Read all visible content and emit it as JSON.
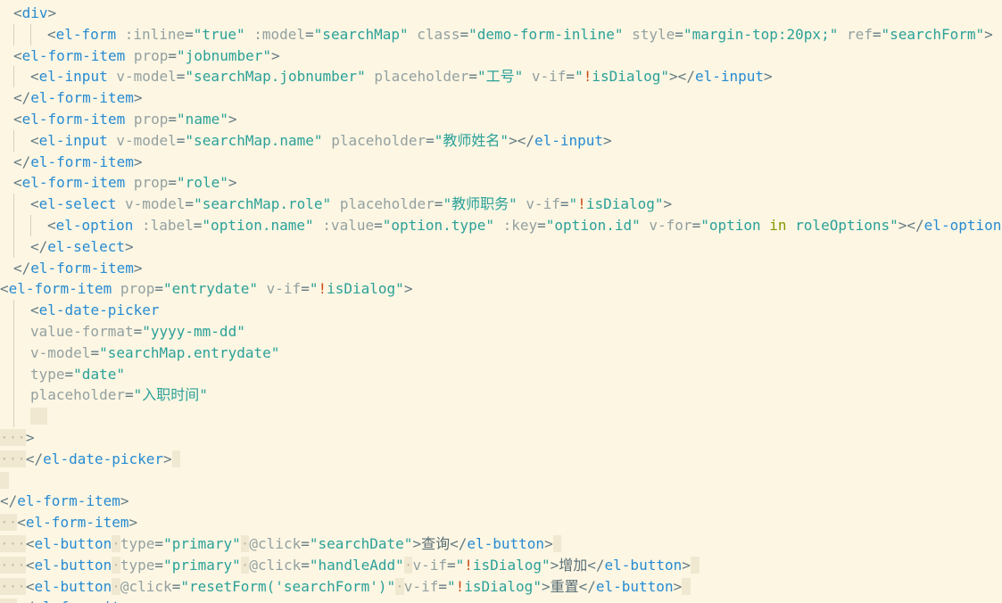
{
  "colors": {
    "background": "#fdf6e3",
    "tag": "#268bd2",
    "attribute": "#93a1a1",
    "string": "#2aa198",
    "keyword": "#859900",
    "text": "#586e75",
    "whitespace_highlight": "#f0e8d0"
  },
  "lines": [
    {
      "indent": 15,
      "guides": [],
      "tokens": [
        [
          "punc",
          "<"
        ],
        [
          "tag",
          "div"
        ],
        [
          "punc",
          ">"
        ]
      ]
    },
    {
      "indent": 53,
      "guides": [
        15,
        34
      ],
      "tokens": [
        [
          "punc",
          "<"
        ],
        [
          "tag",
          "el-form"
        ],
        [
          "text",
          " "
        ],
        [
          "attr",
          ":inline"
        ],
        [
          "punc",
          "="
        ],
        [
          "str",
          "\"true\""
        ],
        [
          "text",
          " "
        ],
        [
          "attr",
          ":model"
        ],
        [
          "punc",
          "="
        ],
        [
          "str",
          "\"searchMap\""
        ],
        [
          "text",
          " "
        ],
        [
          "attr",
          "class"
        ],
        [
          "punc",
          "="
        ],
        [
          "str",
          "\"demo-form-inline\""
        ],
        [
          "text",
          " "
        ],
        [
          "attr",
          "style"
        ],
        [
          "punc",
          "="
        ],
        [
          "str",
          "\"margin-top:20px;\""
        ],
        [
          "text",
          " "
        ],
        [
          "attr",
          "ref"
        ],
        [
          "punc",
          "="
        ],
        [
          "str",
          "\"searchForm\""
        ],
        [
          "punc",
          ">"
        ]
      ]
    },
    {
      "indent": 15,
      "guides": [],
      "tokens": [
        [
          "punc",
          "<"
        ],
        [
          "tag",
          "el-form-item"
        ],
        [
          "text",
          " "
        ],
        [
          "attr",
          "prop"
        ],
        [
          "punc",
          "="
        ],
        [
          "str",
          "\"jobnumber\""
        ],
        [
          "punc",
          ">"
        ]
      ]
    },
    {
      "indent": 34,
      "guides": [
        15
      ],
      "tokens": [
        [
          "punc",
          "<"
        ],
        [
          "tag",
          "el-input"
        ],
        [
          "text",
          " "
        ],
        [
          "attr",
          "v-model"
        ],
        [
          "punc",
          "="
        ],
        [
          "str",
          "\"searchMap.jobnumber\""
        ],
        [
          "text",
          " "
        ],
        [
          "attr",
          "placeholder"
        ],
        [
          "punc",
          "="
        ],
        [
          "str",
          "\"工号\""
        ],
        [
          "text",
          " "
        ],
        [
          "attr",
          "v-if"
        ],
        [
          "punc",
          "="
        ],
        [
          "str",
          "\""
        ],
        [
          "bang",
          "!"
        ],
        [
          "str",
          "isDialog\""
        ],
        [
          "punc",
          "></"
        ],
        [
          "tag",
          "el-input"
        ],
        [
          "punc",
          ">"
        ]
      ]
    },
    {
      "indent": 15,
      "guides": [],
      "tokens": [
        [
          "punc",
          "</"
        ],
        [
          "tag",
          "el-form-item"
        ],
        [
          "punc",
          ">"
        ]
      ]
    },
    {
      "indent": 15,
      "guides": [],
      "tokens": [
        [
          "punc",
          "<"
        ],
        [
          "tag",
          "el-form-item"
        ],
        [
          "text",
          " "
        ],
        [
          "attr",
          "prop"
        ],
        [
          "punc",
          "="
        ],
        [
          "str",
          "\"name\""
        ],
        [
          "punc",
          ">"
        ]
      ]
    },
    {
      "indent": 34,
      "guides": [
        15
      ],
      "tokens": [
        [
          "punc",
          "<"
        ],
        [
          "tag",
          "el-input"
        ],
        [
          "text",
          " "
        ],
        [
          "attr",
          "v-model"
        ],
        [
          "punc",
          "="
        ],
        [
          "str",
          "\"searchMap.name\""
        ],
        [
          "text",
          " "
        ],
        [
          "attr",
          "placeholder"
        ],
        [
          "punc",
          "="
        ],
        [
          "str",
          "\"教师姓名\""
        ],
        [
          "punc",
          "></"
        ],
        [
          "tag",
          "el-input"
        ],
        [
          "punc",
          ">"
        ]
      ]
    },
    {
      "indent": 15,
      "guides": [],
      "tokens": [
        [
          "punc",
          "</"
        ],
        [
          "tag",
          "el-form-item"
        ],
        [
          "punc",
          ">"
        ]
      ]
    },
    {
      "indent": 15,
      "guides": [],
      "tokens": [
        [
          "punc",
          "<"
        ],
        [
          "tag",
          "el-form-item"
        ],
        [
          "text",
          " "
        ],
        [
          "attr",
          "prop"
        ],
        [
          "punc",
          "="
        ],
        [
          "str",
          "\"role\""
        ],
        [
          "punc",
          ">"
        ]
      ]
    },
    {
      "indent": 34,
      "guides": [
        15
      ],
      "tokens": [
        [
          "punc",
          "<"
        ],
        [
          "tag",
          "el-select"
        ],
        [
          "text",
          " "
        ],
        [
          "attr",
          "v-model"
        ],
        [
          "punc",
          "="
        ],
        [
          "str",
          "\"searchMap.role\""
        ],
        [
          "text",
          " "
        ],
        [
          "attr",
          "placeholder"
        ],
        [
          "punc",
          "="
        ],
        [
          "str",
          "\"教师职务\""
        ],
        [
          "text",
          " "
        ],
        [
          "attr",
          "v-if"
        ],
        [
          "punc",
          "="
        ],
        [
          "str",
          "\""
        ],
        [
          "bang",
          "!"
        ],
        [
          "str",
          "isDialog\""
        ],
        [
          "punc",
          ">"
        ]
      ]
    },
    {
      "indent": 53,
      "guides": [
        15,
        34
      ],
      "tokens": [
        [
          "punc",
          "<"
        ],
        [
          "tag",
          "el-option"
        ],
        [
          "text",
          " "
        ],
        [
          "attr",
          ":label"
        ],
        [
          "punc",
          "="
        ],
        [
          "str",
          "\"option.name\""
        ],
        [
          "text",
          " "
        ],
        [
          "attr",
          ":value"
        ],
        [
          "punc",
          "="
        ],
        [
          "str",
          "\"option.type\""
        ],
        [
          "text",
          " "
        ],
        [
          "attr",
          ":key"
        ],
        [
          "punc",
          "="
        ],
        [
          "str",
          "\"option.id\""
        ],
        [
          "text",
          " "
        ],
        [
          "attr",
          "v-for"
        ],
        [
          "punc",
          "="
        ],
        [
          "str",
          "\"option "
        ],
        [
          "kw",
          "in"
        ],
        [
          "str",
          " roleOptions\""
        ],
        [
          "punc",
          "></"
        ],
        [
          "tag",
          "el-option"
        ],
        [
          "punc",
          ">"
        ]
      ]
    },
    {
      "indent": 34,
      "guides": [
        15
      ],
      "tokens": [
        [
          "punc",
          "</"
        ],
        [
          "tag",
          "el-select"
        ],
        [
          "punc",
          ">"
        ]
      ]
    },
    {
      "indent": 15,
      "guides": [],
      "tokens": [
        [
          "punc",
          "</"
        ],
        [
          "tag",
          "el-form-item"
        ],
        [
          "punc",
          ">"
        ]
      ]
    },
    {
      "indent": 0,
      "guides": [],
      "tokens": [
        [
          "punc",
          "<"
        ],
        [
          "tag",
          "el-form-item"
        ],
        [
          "text",
          " "
        ],
        [
          "attr",
          "prop"
        ],
        [
          "punc",
          "="
        ],
        [
          "str",
          "\"entrydate\""
        ],
        [
          "text",
          " "
        ],
        [
          "attr",
          "v-if"
        ],
        [
          "punc",
          "="
        ],
        [
          "str",
          "\""
        ],
        [
          "bang",
          "!"
        ],
        [
          "str",
          "isDialog\""
        ],
        [
          "punc",
          ">"
        ]
      ]
    },
    {
      "indent": 34,
      "guides": [
        15
      ],
      "tokens": [
        [
          "punc",
          "<"
        ],
        [
          "tag",
          "el-date-picker"
        ]
      ]
    },
    {
      "indent": 34,
      "guides": [
        15
      ],
      "tokens": [
        [
          "attr",
          "value-format"
        ],
        [
          "punc",
          "="
        ],
        [
          "str",
          "\"yyyy-mm-dd\""
        ]
      ]
    },
    {
      "indent": 34,
      "guides": [
        15
      ],
      "tokens": [
        [
          "attr",
          "v-model"
        ],
        [
          "punc",
          "="
        ],
        [
          "str",
          "\"searchMap.entrydate\""
        ]
      ]
    },
    {
      "indent": 34,
      "guides": [
        15
      ],
      "tokens": [
        [
          "attr",
          "type"
        ],
        [
          "punc",
          "="
        ],
        [
          "str",
          "\"date\""
        ]
      ]
    },
    {
      "indent": 34,
      "guides": [
        15
      ],
      "tokens": [
        [
          "attr",
          "placeholder"
        ],
        [
          "punc",
          "="
        ],
        [
          "str",
          "\"入职时间\""
        ]
      ]
    },
    {
      "indent": 34,
      "guides": [
        15
      ],
      "tokens": [
        [
          "ws",
          "  "
        ]
      ]
    },
    {
      "indent": 0,
      "guides": [],
      "tokens": [
        [
          "ws",
          "···"
        ],
        [
          "punc",
          ">"
        ]
      ]
    },
    {
      "indent": 0,
      "guides": [],
      "tokens": [
        [
          "ws",
          "···"
        ],
        [
          "punc",
          "</"
        ],
        [
          "tag",
          "el-date-picker"
        ],
        [
          "punc",
          ">"
        ],
        [
          "ws",
          " "
        ]
      ]
    },
    {
      "indent": 0,
      "guides": [],
      "tokens": [
        [
          "ws",
          " "
        ]
      ]
    },
    {
      "indent": 0,
      "guides": [],
      "tokens": [
        [
          "punc",
          "</"
        ],
        [
          "tag",
          "el-form-item"
        ],
        [
          "punc",
          ">"
        ]
      ]
    },
    {
      "indent": 0,
      "guides": [],
      "tokens": [
        [
          "ws",
          "··"
        ],
        [
          "punc",
          "<"
        ],
        [
          "tag",
          "el-form-item"
        ],
        [
          "punc",
          ">"
        ]
      ]
    },
    {
      "indent": 0,
      "guides": [],
      "tokens": [
        [
          "ws",
          "···"
        ],
        [
          "punc",
          "<"
        ],
        [
          "tag",
          "el-button"
        ],
        [
          "ws",
          "·"
        ],
        [
          "attr",
          "type"
        ],
        [
          "punc",
          "="
        ],
        [
          "str",
          "\"primary\""
        ],
        [
          "ws",
          "·"
        ],
        [
          "attr",
          "@click"
        ],
        [
          "punc",
          "="
        ],
        [
          "str",
          "\"searchDate\""
        ],
        [
          "punc",
          ">"
        ],
        [
          "text",
          "查询"
        ],
        [
          "punc",
          "</"
        ],
        [
          "tag",
          "el-button"
        ],
        [
          "punc",
          ">"
        ],
        [
          "ws",
          " "
        ]
      ]
    },
    {
      "indent": 0,
      "guides": [],
      "tokens": [
        [
          "ws",
          "···"
        ],
        [
          "punc",
          "<"
        ],
        [
          "tag",
          "el-button"
        ],
        [
          "ws",
          "·"
        ],
        [
          "attr",
          "type"
        ],
        [
          "punc",
          "="
        ],
        [
          "str",
          "\"primary\""
        ],
        [
          "ws",
          "·"
        ],
        [
          "attr",
          "@click"
        ],
        [
          "punc",
          "="
        ],
        [
          "str",
          "\"handleAdd\""
        ],
        [
          "ws",
          "·"
        ],
        [
          "attr",
          "v-if"
        ],
        [
          "punc",
          "="
        ],
        [
          "str",
          "\""
        ],
        [
          "bang",
          "!"
        ],
        [
          "str",
          "isDialog\""
        ],
        [
          "punc",
          ">"
        ],
        [
          "text",
          "增加"
        ],
        [
          "punc",
          "</"
        ],
        [
          "tag",
          "el-button"
        ],
        [
          "punc",
          ">"
        ],
        [
          "ws",
          " "
        ]
      ]
    },
    {
      "indent": 0,
      "guides": [],
      "tokens": [
        [
          "ws",
          "···"
        ],
        [
          "punc",
          "<"
        ],
        [
          "tag",
          "el-button"
        ],
        [
          "ws",
          "·"
        ],
        [
          "attr",
          "@click"
        ],
        [
          "punc",
          "="
        ],
        [
          "str",
          "\"resetForm('searchForm')\""
        ],
        [
          "ws",
          "·"
        ],
        [
          "attr",
          "v-if"
        ],
        [
          "punc",
          "="
        ],
        [
          "str",
          "\""
        ],
        [
          "bang",
          "!"
        ],
        [
          "str",
          "isDialog\""
        ],
        [
          "punc",
          ">"
        ],
        [
          "text",
          "重置"
        ],
        [
          "punc",
          "</"
        ],
        [
          "tag",
          "el-button"
        ],
        [
          "punc",
          ">"
        ],
        [
          "ws",
          " "
        ]
      ]
    },
    {
      "indent": 0,
      "guides": [],
      "tokens": [
        [
          "ws",
          "··"
        ],
        [
          "punc",
          "</"
        ],
        [
          "tag",
          "el-form-item"
        ],
        [
          "punc",
          ">"
        ]
      ]
    }
  ]
}
